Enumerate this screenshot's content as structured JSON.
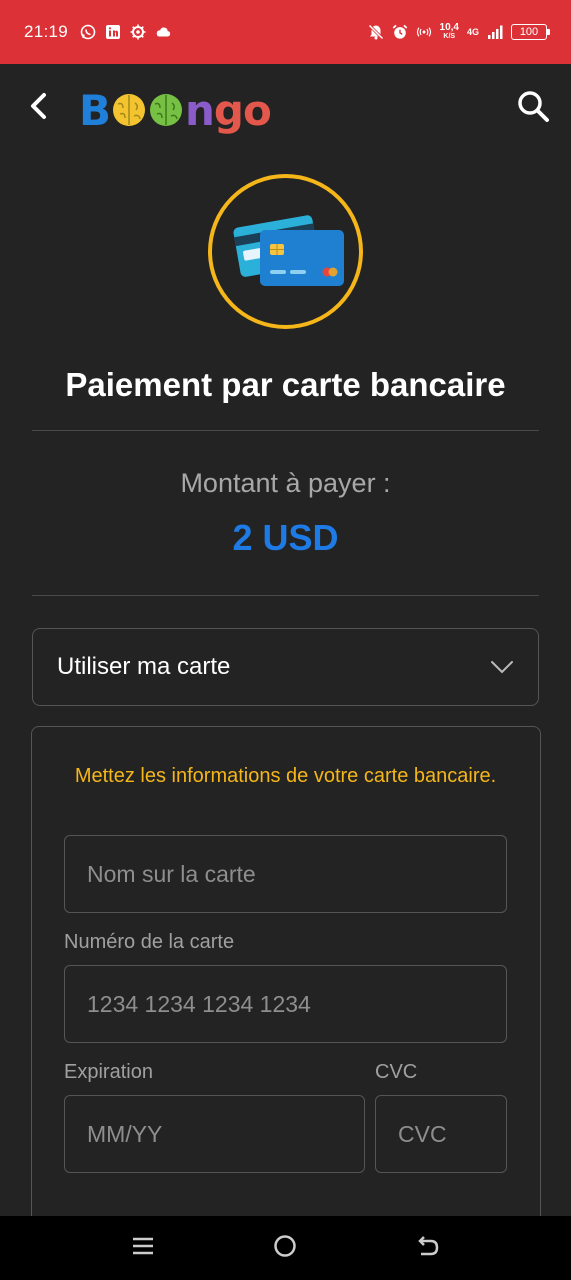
{
  "status_bar": {
    "time": "21:19",
    "speed_top": "10,4",
    "speed_unit": "K/S",
    "network": "4G",
    "battery": "100"
  },
  "header": {
    "back_icon": "chevron-left-icon",
    "logo_text": "Boongo",
    "search_icon": "search-icon"
  },
  "page": {
    "title": "Paiement par carte bancaire",
    "amount_label": "Montant à payer :",
    "amount_value": "2 USD"
  },
  "payment_method": {
    "selected": "Utiliser ma carte"
  },
  "card_form": {
    "hint": "Mettez les informations de votre carte bancaire.",
    "name_placeholder": "Nom sur la carte",
    "number_label": "Numéro de la carte",
    "number_placeholder": "1234 1234 1234 1234",
    "expiry_label": "Expiration",
    "expiry_placeholder": "MM/YY",
    "cvc_label": "CVC",
    "cvc_placeholder": "CVC"
  },
  "colors": {
    "status_bar": "#dc3237",
    "background": "#232323",
    "accent_blue": "#1e7be6",
    "hint_yellow": "#f5b619"
  }
}
